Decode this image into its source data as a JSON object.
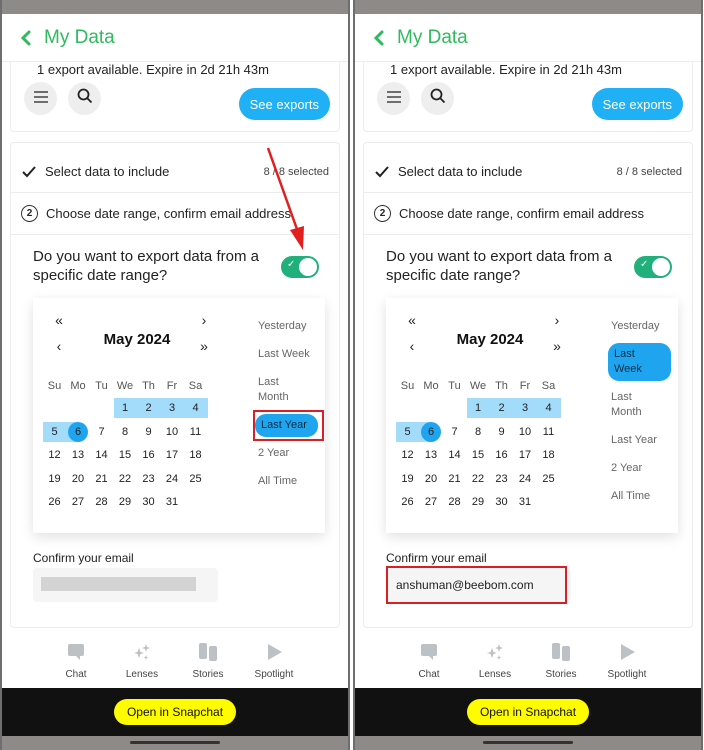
{
  "panels": [
    {
      "header": {
        "title": "My Data"
      },
      "export_info": "1 export available. Expire in 2d 21h 43m",
      "see_exports_label": "See exports",
      "steps": {
        "step1_label": "Select data to include",
        "step1_count": "8 / 8 selected",
        "step2_number": "2",
        "step2_label": "Choose date range, confirm email address"
      },
      "question": "Do you want to export data from a specific date range?",
      "toggle_on": true,
      "calendar": {
        "month_title": "May 2024",
        "weekdays": [
          "Su",
          "Mo",
          "Tu",
          "We",
          "Th",
          "Fr",
          "Sa"
        ],
        "range_start": 1,
        "selected_day": 6,
        "presets": [
          "Yesterday",
          "Last Week",
          "Last Month",
          "Last Year",
          "2 Year",
          "All Time"
        ],
        "active_preset": "Last Year"
      },
      "confirm_label": "Confirm your email",
      "email_value": "",
      "email_redacted": true,
      "annotation": "red arrow pointing to toggle; red box around Last Year"
    },
    {
      "header": {
        "title": "My Data"
      },
      "export_info": "1 export available. Expire in 2d 21h 43m",
      "see_exports_label": "See exports",
      "steps": {
        "step1_label": "Select data to include",
        "step1_count": "8 / 8 selected",
        "step2_number": "2",
        "step2_label": "Choose date range, confirm email address"
      },
      "question": "Do you want to export data from a specific date range?",
      "toggle_on": true,
      "calendar": {
        "month_title": "May 2024",
        "weekdays": [
          "Su",
          "Mo",
          "Tu",
          "We",
          "Th",
          "Fr",
          "Sa"
        ],
        "range_start": 1,
        "selected_day": 6,
        "presets": [
          "Yesterday",
          "Last Week",
          "Last Month",
          "Last Year",
          "2 Year",
          "All Time"
        ],
        "active_preset": "Last Week"
      },
      "confirm_label": "Confirm your email",
      "email_value": "anshuman@beebom.com",
      "email_redacted": false,
      "annotation": "red box around email field"
    }
  ],
  "bottom_nav": [
    "Chat",
    "Lenses",
    "Stories",
    "Spotlight"
  ],
  "open_app_label": "Open in Snapchat",
  "colors": {
    "brand_green": "#2dbb5d",
    "accent_blue": "#1fa5f0",
    "range_blue": "#a3dcfa",
    "toggle_green": "#21b07b",
    "snap_yellow": "#fffc00",
    "annotation_red": "#d91f26"
  }
}
